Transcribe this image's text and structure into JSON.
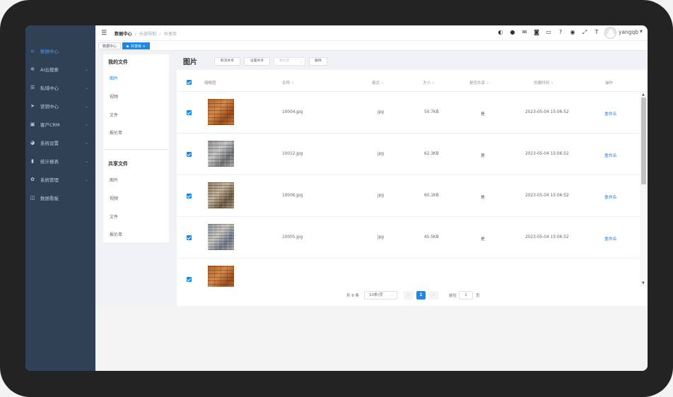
{
  "sidebar": {
    "items": [
      {
        "label": "数据中心",
        "icon": "home-icon",
        "active": true
      },
      {
        "label": "AI云搜索",
        "icon": "gear-icon",
        "active": false
      },
      {
        "label": "私域中心",
        "icon": "list-icon",
        "active": false
      },
      {
        "label": "营销中心",
        "icon": "send-icon",
        "active": false
      },
      {
        "label": "客户CRM",
        "icon": "contact-icon",
        "active": false
      },
      {
        "label": "系统设置",
        "icon": "pie-icon",
        "active": false
      },
      {
        "label": "统计报表",
        "icon": "bar-chart-icon",
        "active": false
      },
      {
        "label": "系统管理",
        "icon": "cog-icon",
        "active": false
      },
      {
        "label": "数据看板",
        "icon": "board-icon",
        "active": false
      }
    ]
  },
  "header": {
    "breadcrumb": [
      "数据中心",
      "头部导航",
      "共享库"
    ],
    "username": "yangqb"
  },
  "tags": {
    "items": [
      "数据中心",
      "共享库"
    ]
  },
  "left_panel": {
    "my_files": {
      "title": "我的文件",
      "items": [
        "图片",
        "视频",
        "文件",
        "报价单"
      ]
    },
    "shared_files": {
      "title": "共享文件",
      "items": [
        "图片",
        "视频",
        "文件",
        "报价单"
      ]
    }
  },
  "main": {
    "title": "图片",
    "buttons": {
      "cancel_share": "取消共享",
      "set_share": "设置共享",
      "move_to": "移动至",
      "delete": "删除"
    },
    "columns": {
      "thumbnail": "缩略图",
      "name": "名称",
      "format": "格式",
      "size": "大小",
      "shared": "是否共享",
      "created": "创建时间",
      "action": "操作"
    },
    "rows": [
      {
        "name": "10004.jpg",
        "format": "jpg",
        "size": "50.7KB",
        "shared": "是",
        "created": "2023-05-04 15:06:52",
        "action": "重命名",
        "checked": true,
        "swatch": "orange"
      },
      {
        "name": "10012.jpg",
        "format": "jpg",
        "size": "62.3KB",
        "shared": "是",
        "created": "2023-05-04 15:06:52",
        "action": "重命名",
        "checked": true,
        "swatch": "gray"
      },
      {
        "name": "10006.jpg",
        "format": "jpg",
        "size": "60.1KB",
        "shared": "是",
        "created": "2023-05-04 15:06:52",
        "action": "重命名",
        "checked": true,
        "swatch": "stone"
      },
      {
        "name": "10005.jpg",
        "format": "jpg",
        "size": "45.5KB",
        "shared": "是",
        "created": "2023-05-04 15:06:52",
        "action": "重命名",
        "checked": true,
        "swatch": "blue"
      },
      {
        "name": "",
        "format": "",
        "size": "",
        "shared": "",
        "created": "",
        "action": "",
        "checked": true,
        "swatch": "orange"
      }
    ]
  },
  "pagination": {
    "total": "共 9 条",
    "page_size": "10条/页",
    "current": "1",
    "goto_label": "前往",
    "goto_value": "1",
    "page_suffix": "页"
  },
  "colors": {
    "sidebar_bg": "#304156",
    "accent": "#1e88e5"
  }
}
